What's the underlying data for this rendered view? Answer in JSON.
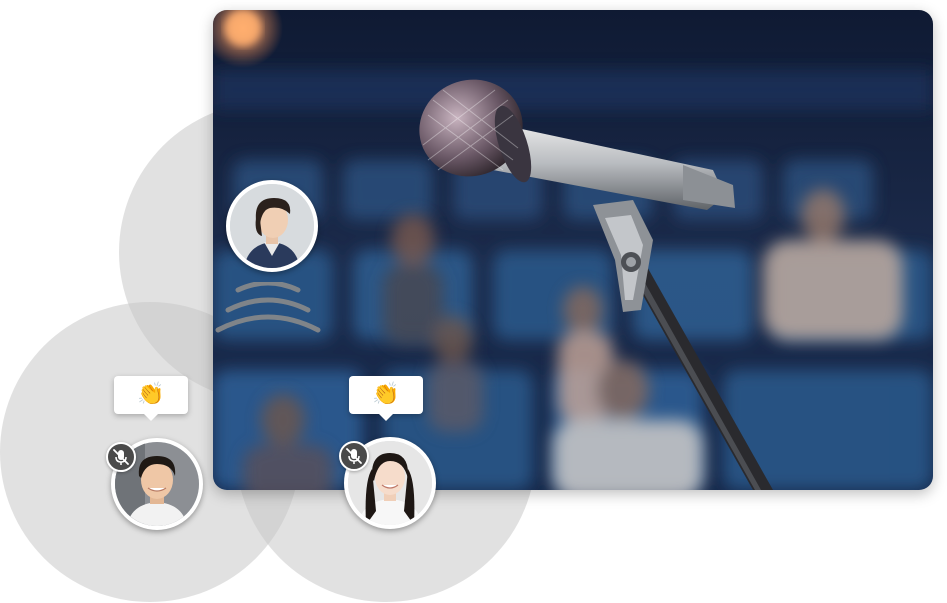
{
  "scene": {
    "image_icon": "microphone-on-stand-icon",
    "background_color": "#1b2a4a",
    "seat_color": "#2c5a8c"
  },
  "participants": [
    {
      "role": "speaker",
      "icon": "woman-avatar-icon",
      "speaking": true
    },
    {
      "role": "listener",
      "icon": "man-avatar-icon",
      "muted": true,
      "reaction": "👏"
    },
    {
      "role": "listener",
      "icon": "woman-avatar-icon",
      "muted": true,
      "reaction": "👏"
    }
  ],
  "icons": {
    "mute": "mic-off-icon",
    "sound": "sound-waves-icon"
  },
  "colors": {
    "circle": "#c8c8c8",
    "badge": "#4a4a4a",
    "bubble": "#ffffff"
  }
}
